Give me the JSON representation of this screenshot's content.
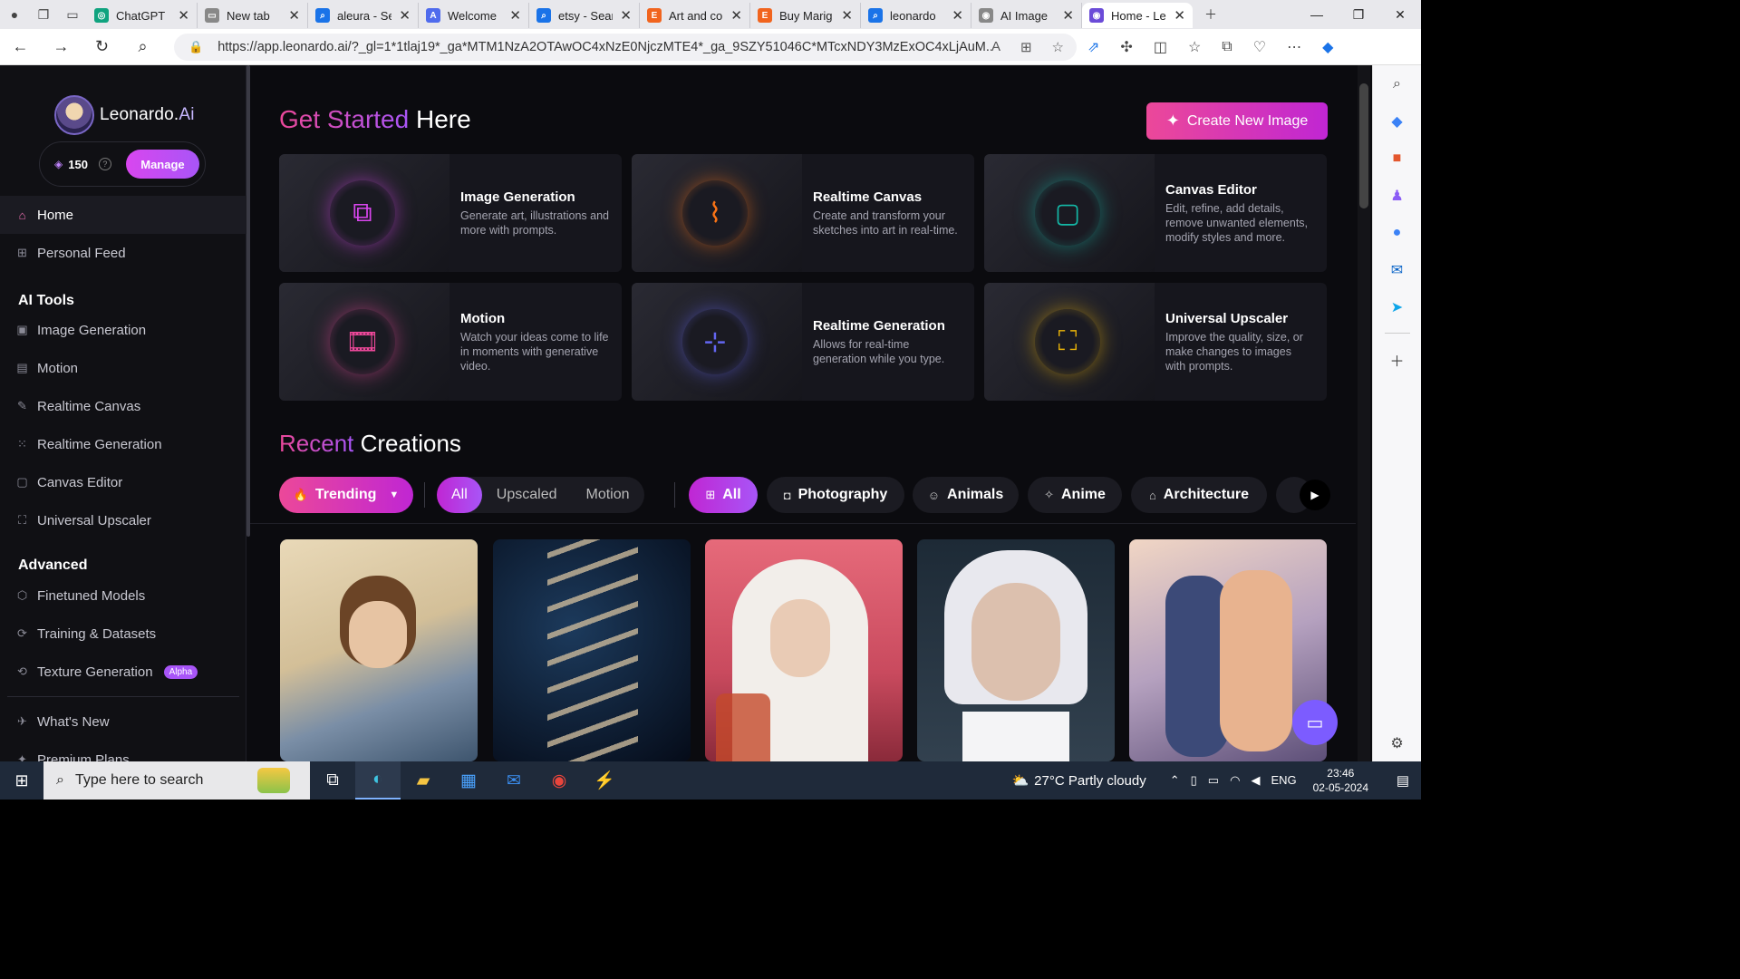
{
  "browser": {
    "tabs": [
      {
        "label": "ChatGPT",
        "color": "#10a37f",
        "glyph": "◎"
      },
      {
        "label": "New tab",
        "color": "#888888",
        "glyph": "▭"
      },
      {
        "label": "aleura - Se",
        "color": "#1a73e8",
        "glyph": "⌕"
      },
      {
        "label": "Welcome",
        "color": "#4f6bed",
        "glyph": "A"
      },
      {
        "label": "etsy - Sear",
        "color": "#1a73e8",
        "glyph": "⌕"
      },
      {
        "label": "Art and co",
        "color": "#f1641e",
        "glyph": "E"
      },
      {
        "label": "Buy Marig",
        "color": "#f1641e",
        "glyph": "E"
      },
      {
        "label": "leonardo",
        "color": "#1a73e8",
        "glyph": "⌕"
      },
      {
        "label": "AI Image",
        "color": "#888888",
        "glyph": "◉"
      },
      {
        "label": "Home - Le",
        "color": "#6b4bd8",
        "glyph": "◉"
      }
    ],
    "url": "https://app.leonardo.ai/?_gl=1*1tlaj19*_ga*MTM1NzA2OTAwOC4xNzE0NjczMTE4*_ga_9SZY51046C*MTcxNDY3MzExOC4xLjAuM..."
  },
  "sidebar": {
    "brand": "Leonardo.",
    "brand_suffix": "Ai",
    "credits": "150",
    "manage_label": "Manage",
    "home": "Home",
    "personal_feed": "Personal Feed",
    "ai_tools_heading": "AI Tools",
    "tools": [
      "Image Generation",
      "Motion",
      "Realtime Canvas",
      "Realtime Generation",
      "Canvas Editor",
      "Universal Upscaler"
    ],
    "advanced_heading": "Advanced",
    "advanced": [
      "Finetuned Models",
      "Training & Datasets",
      "Texture Generation"
    ],
    "alpha_badge": "Alpha",
    "whats_new": "What's New",
    "premium": "Premium Plans"
  },
  "main": {
    "title_accent": "Get Started",
    "title_rest": "Here",
    "create_button": "Create New Image",
    "cards": [
      {
        "title": "Image Generation",
        "desc": "Generate art, illustrations and more with prompts.",
        "accent": "#d946ef",
        "icon": "⧉"
      },
      {
        "title": "Realtime Canvas",
        "desc": "Create and transform your sketches into art in real-time.",
        "accent": "#f97316",
        "icon": "⌇"
      },
      {
        "title": "Canvas Editor",
        "desc": "Edit, refine, add details, remove unwanted elements, modify styles and more.",
        "accent": "#14b8a6",
        "icon": "▢"
      },
      {
        "title": "Motion",
        "desc": "Watch your ideas come to life in moments with generative video.",
        "accent": "#ec4899",
        "icon": "🎞"
      },
      {
        "title": "Realtime Generation",
        "desc": "Allows for real-time generation while you type.",
        "accent": "#6366f1",
        "icon": "⊹"
      },
      {
        "title": "Universal Upscaler",
        "desc": "Improve the quality, size, or make changes to images with prompts.",
        "accent": "#eab308",
        "icon": "⛶"
      }
    ],
    "recent_accent": "Recent",
    "recent_rest": "Creations",
    "trending_label": "Trending",
    "filters": [
      "All",
      "Upscaled",
      "Motion"
    ],
    "all_label": "All",
    "categories": [
      "Photography",
      "Animals",
      "Anime",
      "Architecture"
    ]
  },
  "taskbar": {
    "search_placeholder": "Type here to search",
    "weather": "27°C  Partly cloudy",
    "lang": "ENG",
    "time": "23:46",
    "date": "02-05-2024"
  }
}
